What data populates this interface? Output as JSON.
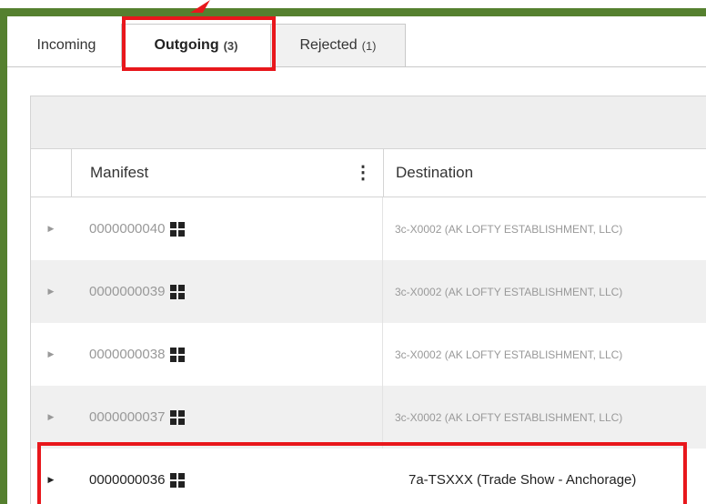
{
  "tabs": [
    {
      "label": "Incoming",
      "count": ""
    },
    {
      "label": "Outgoing",
      "count": "(3)"
    },
    {
      "label": "Rejected",
      "count": "(1)"
    }
  ],
  "grid": {
    "columns": [
      "Manifest",
      "Destination"
    ],
    "rows": [
      {
        "manifest": "0000000040",
        "destination": "3c-X0002 (AK LOFTY ESTABLISHMENT, LLC)"
      },
      {
        "manifest": "0000000039",
        "destination": "3c-X0002 (AK LOFTY ESTABLISHMENT, LLC)"
      },
      {
        "manifest": "0000000038",
        "destination": "3c-X0002 (AK LOFTY ESTABLISHMENT, LLC)"
      },
      {
        "manifest": "0000000037",
        "destination": "3c-X0002 (AK LOFTY ESTABLISHMENT, LLC)"
      },
      {
        "manifest": "0000000036",
        "destination": "7a-TSXXX (Trade Show - Anchorage)"
      }
    ]
  },
  "colors": {
    "frame": "#55802f",
    "highlight": "#e8171c"
  }
}
